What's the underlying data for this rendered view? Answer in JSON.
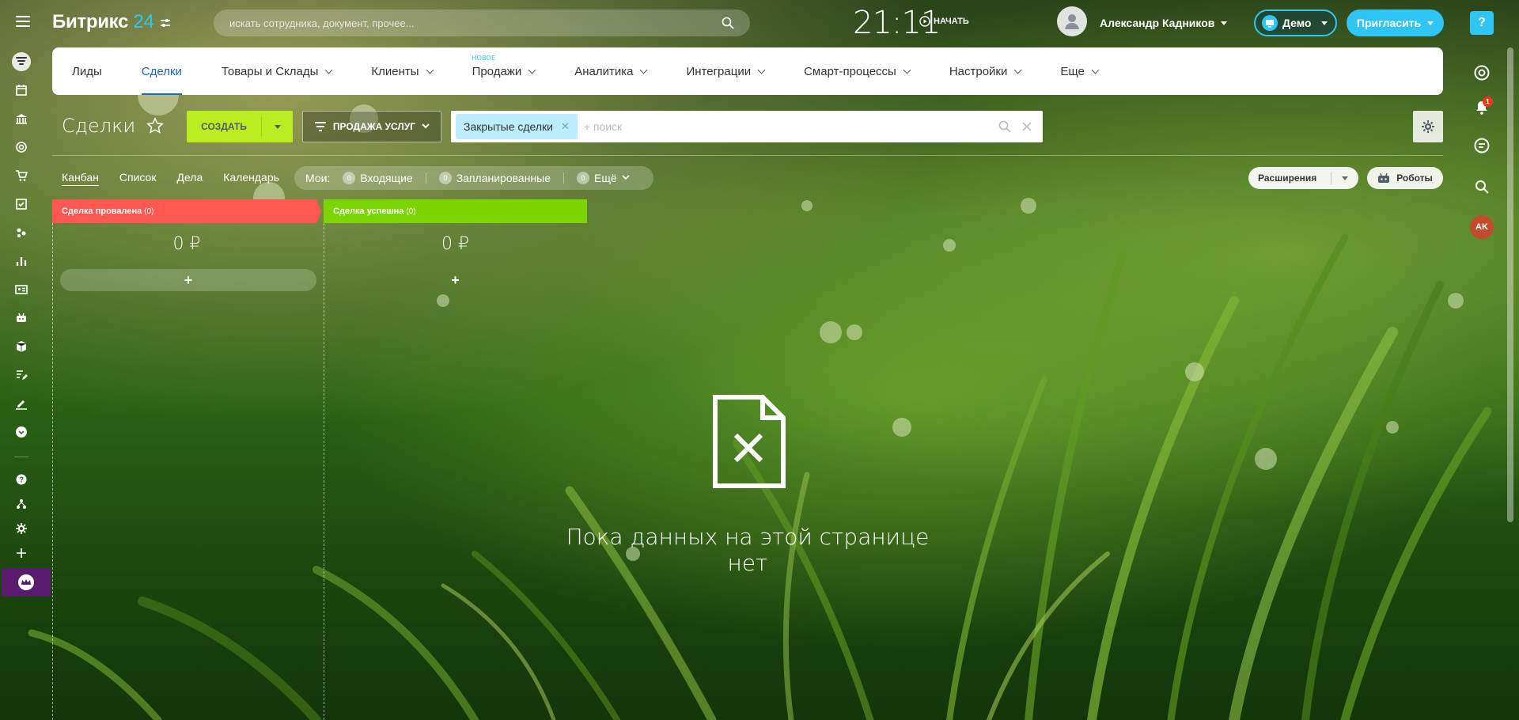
{
  "header": {
    "logo_main": "Битрикс",
    "logo_num": "24",
    "search_placeholder": "искать сотрудника, документ, прочее...",
    "clock": "21:11",
    "start_label": "НАЧАТЬ",
    "user_name": "Александр Кадников",
    "demo_label": "Демо",
    "invite_label": "Пригласить"
  },
  "topmenu": {
    "items": [
      {
        "label": "Лиды"
      },
      {
        "label": "Сделки",
        "active": true
      },
      {
        "label": "Товары и Склады"
      },
      {
        "label": "Клиенты"
      },
      {
        "label": "Продажи",
        "badge": "НОВОЕ"
      },
      {
        "label": "Аналитика"
      },
      {
        "label": "Интеграции"
      },
      {
        "label": "Смарт-процессы"
      },
      {
        "label": "Настройки"
      },
      {
        "label": "Еще"
      }
    ]
  },
  "toolbar": {
    "title": "Сделки",
    "create_label": "СОЗДАТЬ",
    "preset_label": "ПРОДАЖА УСЛУГ",
    "filter_tag": "Закрытые сделки",
    "filter_placeholder": "+ поиск"
  },
  "views": {
    "items": [
      "Канбан",
      "Список",
      "Дела",
      "Календарь"
    ],
    "active": "Канбан"
  },
  "counters": {
    "label": "Мои:",
    "items": [
      {
        "count": "0",
        "label": "Входящие"
      },
      {
        "count": "0",
        "label": "Запланированные"
      },
      {
        "count": "0",
        "label": "Ещё"
      }
    ]
  },
  "buttons": {
    "extensions": "Расширения",
    "robots": "Роботы"
  },
  "kanban": {
    "columns": [
      {
        "title": "Сделка провалена",
        "count": "(0)",
        "sum": "0 ₽",
        "color": "#ff5752"
      },
      {
        "title": "Сделка успешна",
        "count": "(0)",
        "sum": "0 ₽",
        "color": "#7bd500"
      }
    ],
    "add_label": "+"
  },
  "empty_state": {
    "text": "Пока данных на этой странице нет"
  },
  "right_rail": {
    "help": "?",
    "notif_count": "1",
    "avatar_initials": "AK"
  },
  "colors": {
    "accent": "#2fc6f6",
    "create_green": "#bbed21",
    "active_link": "#2067b0"
  }
}
